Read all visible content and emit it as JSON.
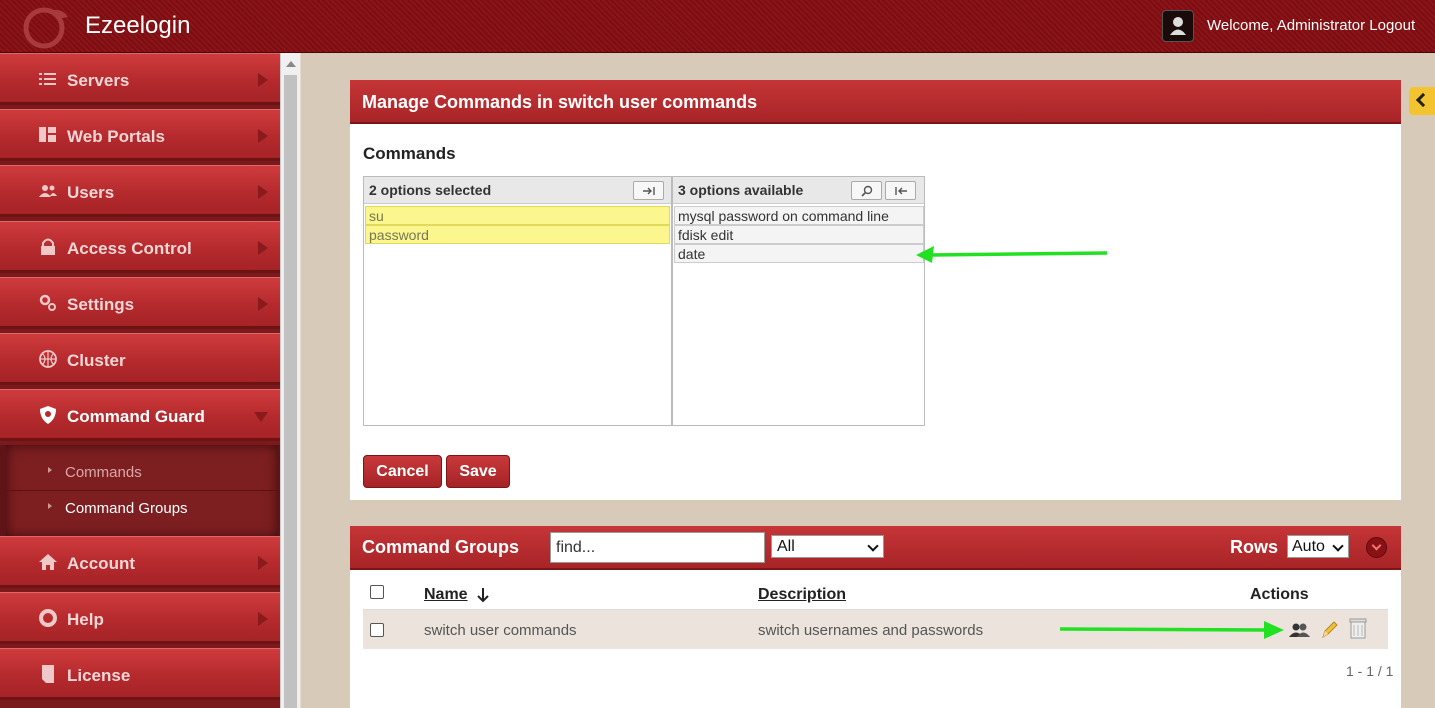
{
  "app": {
    "title": "Ezeelogin",
    "welcome": "Welcome, Administrator Logout"
  },
  "sidebar": {
    "items": [
      {
        "label": "Servers",
        "icon": "list-icon"
      },
      {
        "label": "Web Portals",
        "icon": "dashboard-icon"
      },
      {
        "label": "Users",
        "icon": "users-icon"
      },
      {
        "label": "Access Control",
        "icon": "lock-icon"
      },
      {
        "label": "Settings",
        "icon": "gears-icon"
      },
      {
        "label": "Cluster",
        "icon": "basketball-icon"
      },
      {
        "label": "Command Guard",
        "icon": "shield-icon"
      },
      {
        "label": "Account",
        "icon": "home-icon"
      },
      {
        "label": "Help",
        "icon": "lifebuoy-icon"
      },
      {
        "label": "License",
        "icon": "document-icon"
      }
    ],
    "subitems": [
      {
        "label": "Commands"
      },
      {
        "label": "Command Groups"
      }
    ]
  },
  "manage_panel": {
    "title": "Manage Commands in switch user commands",
    "field_label": "Commands",
    "selected_header": "2 options selected",
    "available_header": "3 options available",
    "selected_options": [
      "su",
      "password"
    ],
    "available_options": [
      "mysql password on command line",
      "fdisk edit",
      "date"
    ],
    "cancel_label": "Cancel",
    "save_label": "Save"
  },
  "groups_panel": {
    "title": "Command Groups",
    "find_value": "find...",
    "filter_value": "All",
    "rows_label": "Rows",
    "rows_value": "Auto",
    "columns": {
      "name": "Name",
      "description": "Description",
      "actions": "Actions"
    },
    "rows": [
      {
        "name": "switch user commands",
        "description": "switch usernames and passwords"
      }
    ],
    "pager": "1 - 1 / 1"
  },
  "colors": {
    "brand_red": "#b52a2d",
    "annotation_arrow": "#22e022",
    "highlight_yellow": "#fbf68e"
  }
}
